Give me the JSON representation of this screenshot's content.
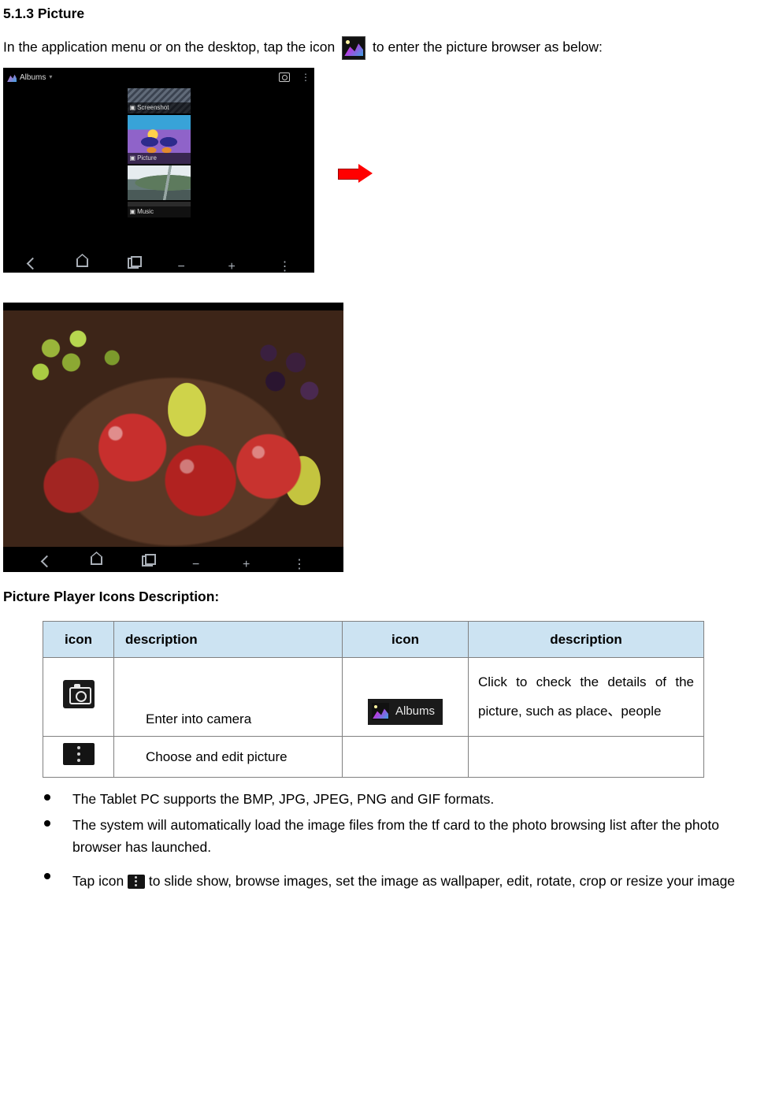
{
  "heading_number": "5.1.3",
  "heading_title": "Picture",
  "intro_prefix": "In the application menu or on the desktop, tap the icon ",
  "intro_suffix": " to enter the picture browser as below:",
  "screenshot1": {
    "header_label": "Albums",
    "thumbs": [
      {
        "label": "Screenshot"
      },
      {
        "label": "Picture"
      },
      {
        "label": "Music"
      }
    ]
  },
  "table_title": "Picture Player Icons Description:",
  "table": {
    "headers": {
      "c1": "icon",
      "c2": "description",
      "c3": "icon",
      "c4": "description"
    },
    "rows": [
      {
        "c2": "Enter into camera",
        "c4": "Click to check the details of the picture, such as place、people",
        "albums_label": "Albums"
      },
      {
        "c2": "Choose and edit picture",
        "c4": ""
      }
    ]
  },
  "bullets": [
    "The Tablet PC supports the BMP, JPG, JPEG, PNG and GIF formats.",
    "The system will automatically load the image files from the tf card to the photo browsing list after the photo browser has launched."
  ],
  "bullet3_prefix": "Tap icon ",
  "bullet3_suffix": " to slide show, browse images, set the image as wallpaper, edit, rotate, crop or resize your image"
}
